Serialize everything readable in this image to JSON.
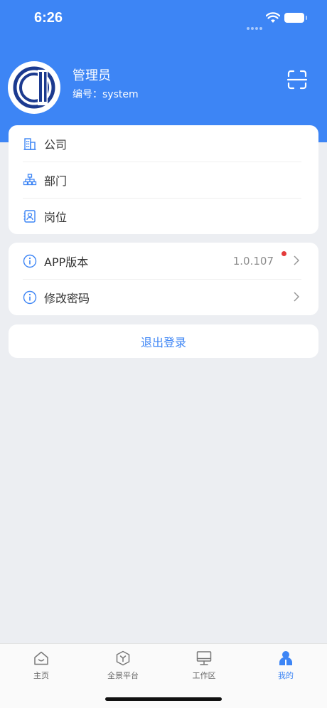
{
  "status_bar": {
    "time": "6:26"
  },
  "profile": {
    "name": "管理员",
    "id_label": "编号：system"
  },
  "org_menu": [
    {
      "label": "公司",
      "icon": "building-icon"
    },
    {
      "label": "部门",
      "icon": "org-chart-icon"
    },
    {
      "label": "岗位",
      "icon": "id-card-icon"
    }
  ],
  "settings_menu": [
    {
      "label": "APP版本",
      "value": "1.0.107",
      "icon": "info-icon",
      "has_badge": true
    },
    {
      "label": "修改密码",
      "icon": "info-icon"
    }
  ],
  "logout_label": "退出登录",
  "tabs": [
    {
      "label": "主页",
      "icon": "home-icon"
    },
    {
      "label": "全景平台",
      "icon": "cube-icon"
    },
    {
      "label": "工作区",
      "icon": "desktop-icon"
    },
    {
      "label": "我的",
      "icon": "user-icon",
      "active": true
    }
  ],
  "colors": {
    "primary": "#3d85f5",
    "background": "#eceef2",
    "badge": "#e43b3b"
  }
}
